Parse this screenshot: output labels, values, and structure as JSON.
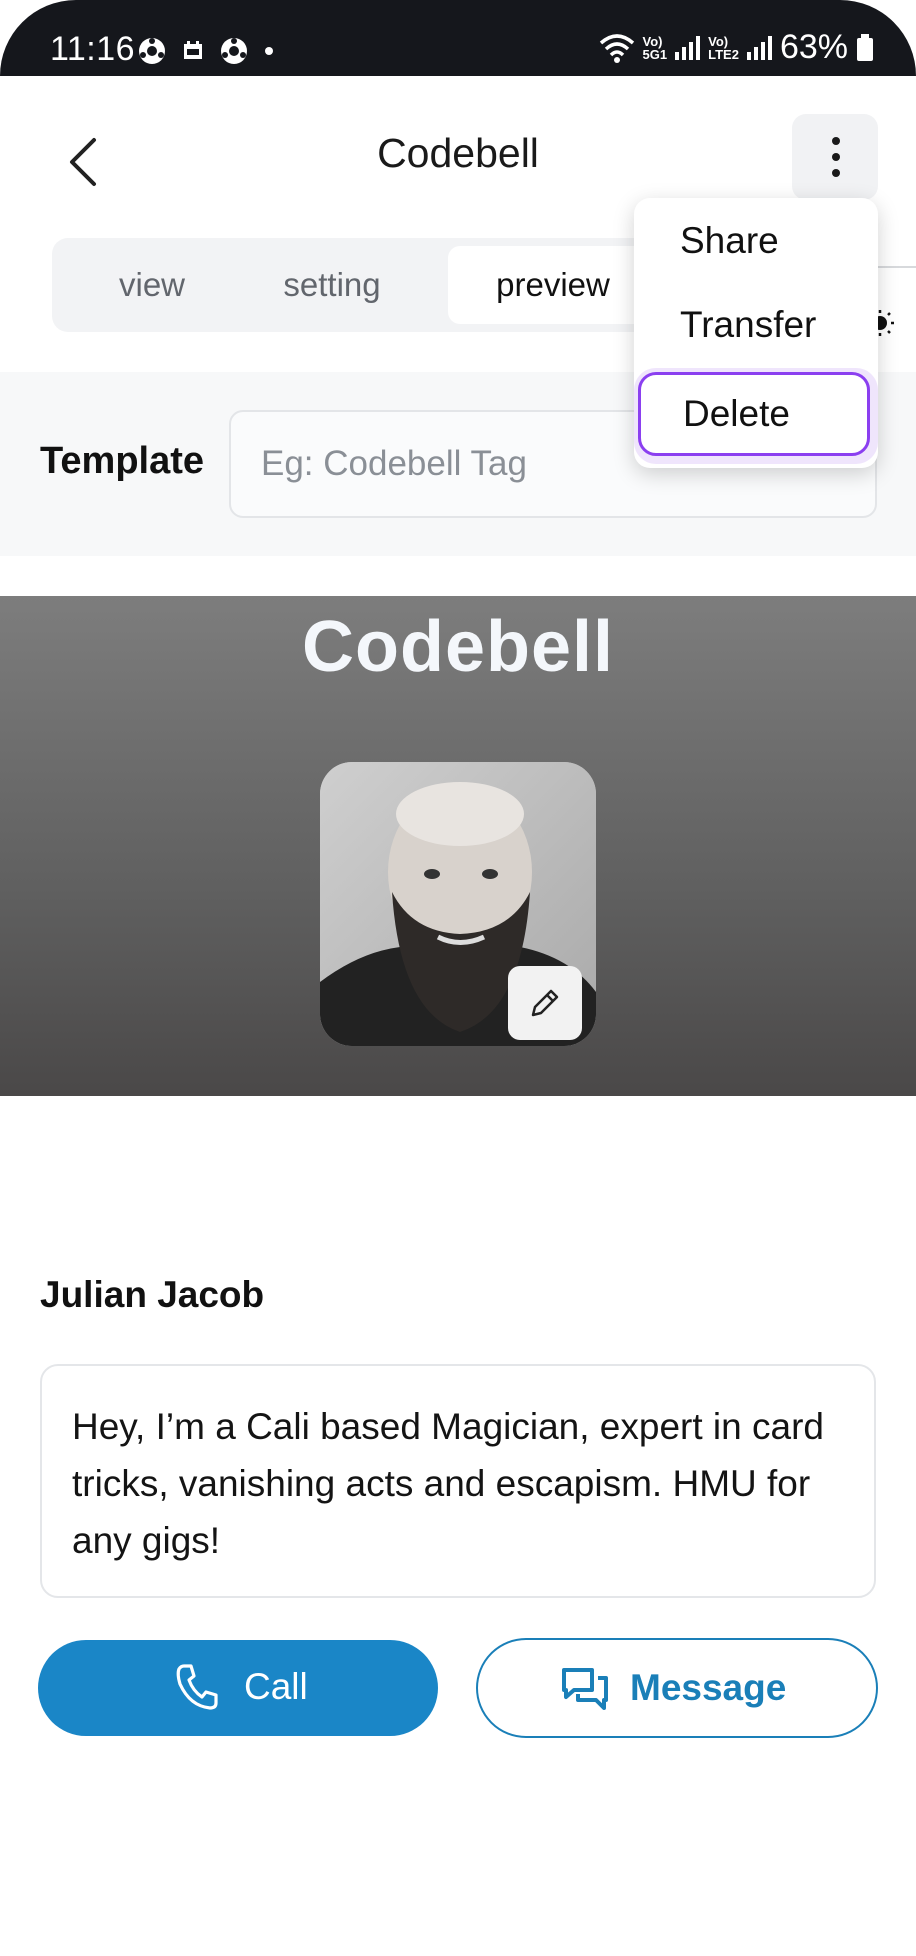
{
  "status_bar": {
    "time": "11:16",
    "net_top": "Vo)",
    "net_sub1": "5G1",
    "net_sub2": "LTE2",
    "battery": "63%"
  },
  "header": {
    "title": "Codebell"
  },
  "tabs": [
    {
      "label": "view",
      "active": false
    },
    {
      "label": "setting",
      "active": false
    },
    {
      "label": "preview",
      "active": true
    }
  ],
  "menu": {
    "items": [
      "Share",
      "Transfer",
      "Delete"
    ],
    "highlighted": "Delete"
  },
  "template": {
    "label": "Template",
    "placeholder": "Eg: Codebell Tag"
  },
  "card": {
    "logo_text": "Codebell",
    "name": "Julian Jacob",
    "bio": "Hey, I’m a Cali based Magician, expert in card tricks, vanishing acts and escapism. HMU for any gigs!",
    "call_label": "Call",
    "message_label": "Message"
  },
  "colors": {
    "accent": "#1a86c7",
    "highlight": "#8b3ff0"
  },
  "icons": [
    "back-chevron-icon",
    "more-vertical-icon",
    "pencil-icon",
    "phone-icon",
    "chat-icon",
    "sun-icon",
    "wifi-icon",
    "battery-icon"
  ]
}
